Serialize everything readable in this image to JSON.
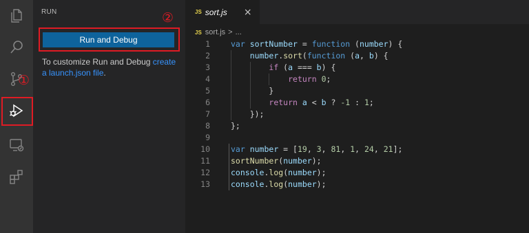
{
  "activity_bar": {
    "items": [
      {
        "name": "explorer-icon"
      },
      {
        "name": "search-icon"
      },
      {
        "name": "source-control-icon"
      },
      {
        "name": "run-debug-icon"
      },
      {
        "name": "remote-explorer-icon"
      },
      {
        "name": "extensions-icon"
      }
    ]
  },
  "annotations": {
    "marker1": "①",
    "marker2": "②",
    "color": "#e01b24"
  },
  "sidebar": {
    "title": "RUN",
    "run_button_label": "Run and Debug",
    "description_prefix": "To customize Run and Debug ",
    "description_link": "create a launch.json file",
    "description_suffix": "."
  },
  "editor": {
    "tab": {
      "badge": "JS",
      "label": "sort.js",
      "close": "×"
    },
    "breadcrumb": {
      "badge": "JS",
      "file": "sort.js",
      "separator": ">",
      "rest": "..."
    },
    "lines": [
      {
        "n": "1",
        "tokens": [
          [
            "kw",
            "var "
          ],
          [
            "var",
            "sortNumber"
          ],
          [
            "pun",
            " = "
          ],
          [
            "kw",
            "function"
          ],
          [
            "pun",
            " ("
          ],
          [
            "var",
            "number"
          ],
          [
            "pun",
            ") {"
          ]
        ]
      },
      {
        "n": "2",
        "tokens": [
          [
            "pun",
            "    "
          ],
          [
            "var",
            "number"
          ],
          [
            "pun",
            "."
          ],
          [
            "fn",
            "sort"
          ],
          [
            "pun",
            "("
          ],
          [
            "kw",
            "function"
          ],
          [
            "pun",
            " ("
          ],
          [
            "var",
            "a"
          ],
          [
            "pun",
            ", "
          ],
          [
            "var",
            "b"
          ],
          [
            "pun",
            ") {"
          ]
        ]
      },
      {
        "n": "3",
        "tokens": [
          [
            "pun",
            "        "
          ],
          [
            "ctl",
            "if"
          ],
          [
            "pun",
            " ("
          ],
          [
            "var",
            "a"
          ],
          [
            "pun",
            " === "
          ],
          [
            "var",
            "b"
          ],
          [
            "pun",
            ") {"
          ]
        ]
      },
      {
        "n": "4",
        "tokens": [
          [
            "pun",
            "            "
          ],
          [
            "ctl",
            "return"
          ],
          [
            "pun",
            " "
          ],
          [
            "num",
            "0"
          ],
          [
            "pun",
            ";"
          ]
        ]
      },
      {
        "n": "5",
        "tokens": [
          [
            "pun",
            "        }"
          ]
        ]
      },
      {
        "n": "6",
        "tokens": [
          [
            "pun",
            "        "
          ],
          [
            "ctl",
            "return"
          ],
          [
            "pun",
            " "
          ],
          [
            "var",
            "a"
          ],
          [
            "pun",
            " < "
          ],
          [
            "var",
            "b"
          ],
          [
            "pun",
            " ? "
          ],
          [
            "num",
            "-1"
          ],
          [
            "pun",
            " : "
          ],
          [
            "num",
            "1"
          ],
          [
            "pun",
            ";"
          ]
        ]
      },
      {
        "n": "7",
        "tokens": [
          [
            "pun",
            "    });"
          ]
        ]
      },
      {
        "n": "8",
        "tokens": [
          [
            "pun",
            "};"
          ]
        ]
      },
      {
        "n": "9",
        "tokens": []
      },
      {
        "n": "10",
        "tokens": [
          [
            "kw",
            "var "
          ],
          [
            "var",
            "number"
          ],
          [
            "pun",
            " = ["
          ],
          [
            "num",
            "19"
          ],
          [
            "pun",
            ", "
          ],
          [
            "num",
            "3"
          ],
          [
            "pun",
            ", "
          ],
          [
            "num",
            "81"
          ],
          [
            "pun",
            ", "
          ],
          [
            "num",
            "1"
          ],
          [
            "pun",
            ", "
          ],
          [
            "num",
            "24"
          ],
          [
            "pun",
            ", "
          ],
          [
            "num",
            "21"
          ],
          [
            "pun",
            "];"
          ]
        ]
      },
      {
        "n": "11",
        "tokens": [
          [
            "fn",
            "sortNumber"
          ],
          [
            "pun",
            "("
          ],
          [
            "var",
            "number"
          ],
          [
            "pun",
            ");"
          ]
        ]
      },
      {
        "n": "12",
        "tokens": [
          [
            "var",
            "console"
          ],
          [
            "pun",
            "."
          ],
          [
            "fn",
            "log"
          ],
          [
            "pun",
            "("
          ],
          [
            "var",
            "number"
          ],
          [
            "pun",
            ");"
          ]
        ]
      },
      {
        "n": "13",
        "tokens": [
          [
            "var",
            "console"
          ],
          [
            "pun",
            "."
          ],
          [
            "fn",
            "log"
          ],
          [
            "pun",
            "("
          ],
          [
            "var",
            "number"
          ],
          [
            "pun",
            ");"
          ]
        ]
      }
    ]
  }
}
